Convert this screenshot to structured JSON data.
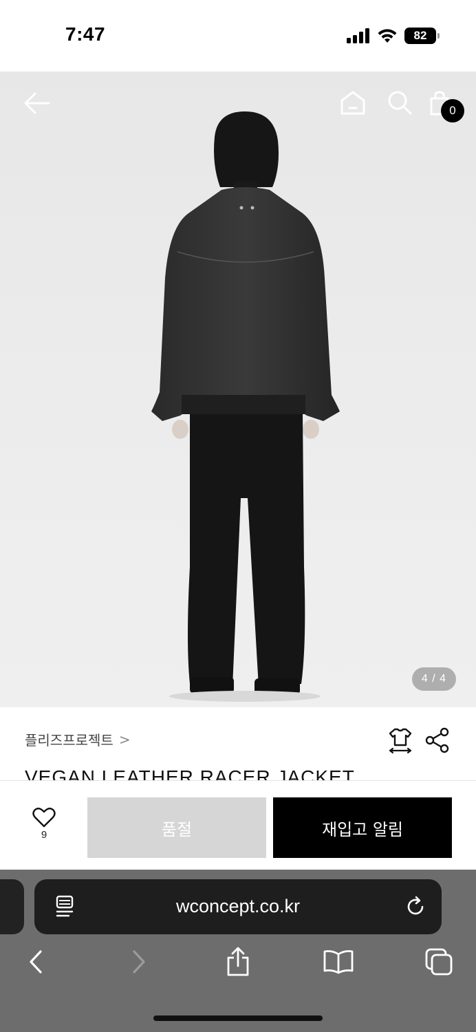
{
  "status_bar": {
    "time": "7:47",
    "battery": "82",
    "icons": [
      "cellular-signal-icon",
      "wifi-icon",
      "battery-icon"
    ]
  },
  "header": {
    "icons": [
      "arrow-left-icon",
      "home-icon",
      "search-icon",
      "shopping-bag-icon"
    ],
    "cart_count": "0"
  },
  "gallery": {
    "counter": "4 / 4"
  },
  "product": {
    "brand": "플리즈프로젝트",
    "brand_chevron": ">",
    "title": "VEGAN LEATHER RACER JACKET",
    "icons": [
      "size-guide-icon",
      "share-icon"
    ]
  },
  "actions": {
    "like_count": "9",
    "soldout_label": "품절",
    "restock_label": "재입고 알림"
  },
  "browser": {
    "url": "wconcept.co.kr",
    "icons": [
      "reader-mode-icon",
      "reload-icon",
      "back-icon",
      "forward-icon",
      "share-icon",
      "bookmarks-icon",
      "tabs-icon"
    ]
  },
  "colors": {
    "accent": "#000000",
    "soldout_bg": "#d6d6d6",
    "browser_chrome": "#6d6d6d"
  }
}
